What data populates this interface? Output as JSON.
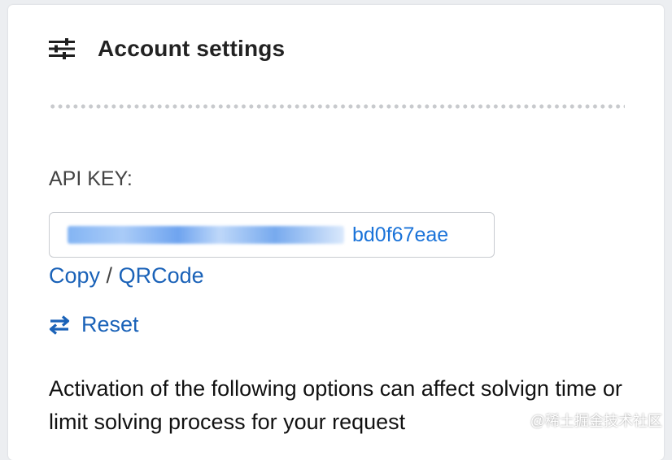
{
  "header": {
    "icon": "sliders-icon",
    "title": "Account settings"
  },
  "api_key": {
    "label": "API KEY:",
    "visible_suffix": "bd0f67eae"
  },
  "actions": {
    "copy": "Copy",
    "separator": "/",
    "qrcode": "QRCode",
    "reset": "Reset",
    "reset_icon": "swap-arrows-icon"
  },
  "description": "Activation of the following options can affect solvign time or limit solving process for your request",
  "watermark": "@稀土掘金技术社区",
  "colors": {
    "link": "#1a62b8",
    "key_text": "#1a73d9",
    "title": "#222222"
  }
}
